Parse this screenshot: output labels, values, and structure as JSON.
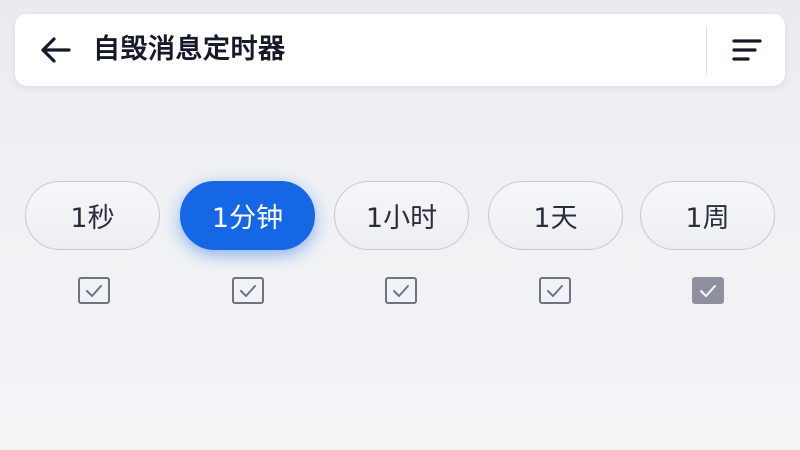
{
  "header": {
    "title": "自毁消息定时器",
    "back_icon": "arrow-left-icon",
    "menu_icon": "sort-lines-icon"
  },
  "timer_options": [
    {
      "label": "1秒",
      "selected": false,
      "checked": true,
      "check_style": "outline"
    },
    {
      "label": "1分钟",
      "selected": true,
      "checked": true,
      "check_style": "outline"
    },
    {
      "label": "1小时",
      "selected": false,
      "checked": true,
      "check_style": "outline"
    },
    {
      "label": "1天",
      "selected": false,
      "checked": true,
      "check_style": "outline"
    },
    {
      "label": "1周",
      "selected": false,
      "checked": true,
      "check_style": "filled"
    }
  ],
  "colors": {
    "accent": "#1567e6",
    "title_text": "#16192a",
    "pill_text": "#2a2e3c",
    "checkbox_border": "#6f7381",
    "checkbox_filled": "#8e919d"
  }
}
